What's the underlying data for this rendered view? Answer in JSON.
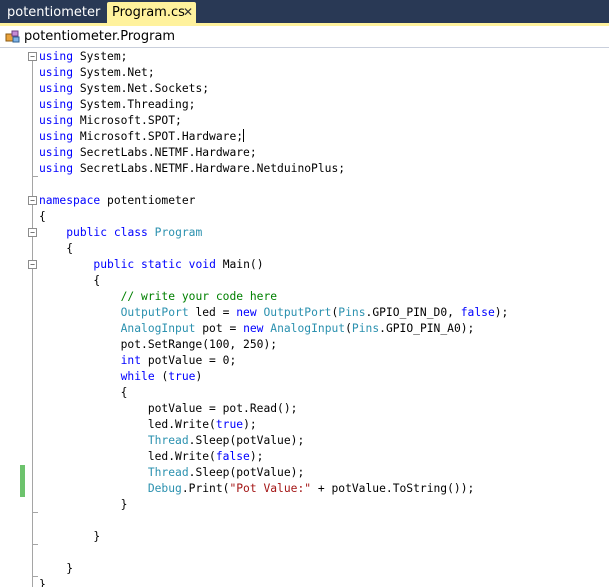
{
  "tabs": {
    "inactive_label": "potentiometer",
    "active_label": "Program.cs",
    "close_glyph": "✕"
  },
  "navbar": {
    "member_label": "potentiometer.Program",
    "icon": "class-icon"
  },
  "colors": {
    "tabbar_background": "#293955",
    "active_tab": "#fff29d",
    "keyword": "#0000ff",
    "type": "#2b91af",
    "comment": "#008000",
    "string": "#a31515",
    "change_marker": "#6dc36d"
  },
  "editor": {
    "lines": [
      [
        {
          "t": "kw",
          "s": "using"
        },
        {
          "t": "",
          "s": " System;"
        }
      ],
      [
        {
          "t": "kw",
          "s": "using"
        },
        {
          "t": "",
          "s": " System.Net;"
        }
      ],
      [
        {
          "t": "kw",
          "s": "using"
        },
        {
          "t": "",
          "s": " System.Net.Sockets;"
        }
      ],
      [
        {
          "t": "kw",
          "s": "using"
        },
        {
          "t": "",
          "s": " System.Threading;"
        }
      ],
      [
        {
          "t": "kw",
          "s": "using"
        },
        {
          "t": "",
          "s": " Microsoft.SPOT;"
        }
      ],
      [
        {
          "t": "kw",
          "s": "using"
        },
        {
          "t": "",
          "s": " Microsoft.SPOT.Hardware;"
        },
        {
          "t": "caret",
          "s": ""
        }
      ],
      [
        {
          "t": "kw",
          "s": "using"
        },
        {
          "t": "",
          "s": " SecretLabs.NETMF.Hardware;"
        }
      ],
      [
        {
          "t": "kw",
          "s": "using"
        },
        {
          "t": "",
          "s": " SecretLabs.NETMF.Hardware.NetduinoPlus;"
        }
      ],
      [],
      [
        {
          "t": "kw",
          "s": "namespace"
        },
        {
          "t": "",
          "s": " potentiometer"
        }
      ],
      [
        {
          "t": "",
          "s": "{"
        }
      ],
      [
        {
          "t": "",
          "s": "    "
        },
        {
          "t": "kw",
          "s": "public"
        },
        {
          "t": "",
          "s": " "
        },
        {
          "t": "kw",
          "s": "class"
        },
        {
          "t": "",
          "s": " "
        },
        {
          "t": "ty",
          "s": "Program"
        }
      ],
      [
        {
          "t": "",
          "s": "    {"
        }
      ],
      [
        {
          "t": "",
          "s": "        "
        },
        {
          "t": "kw",
          "s": "public"
        },
        {
          "t": "",
          "s": " "
        },
        {
          "t": "kw",
          "s": "static"
        },
        {
          "t": "",
          "s": " "
        },
        {
          "t": "kw",
          "s": "void"
        },
        {
          "t": "",
          "s": " Main()"
        }
      ],
      [
        {
          "t": "",
          "s": "        {"
        }
      ],
      [
        {
          "t": "",
          "s": "            "
        },
        {
          "t": "cm",
          "s": "// write your code here"
        }
      ],
      [
        {
          "t": "",
          "s": "            "
        },
        {
          "t": "ty",
          "s": "OutputPort"
        },
        {
          "t": "",
          "s": " led = "
        },
        {
          "t": "kw",
          "s": "new"
        },
        {
          "t": "",
          "s": " "
        },
        {
          "t": "ty",
          "s": "OutputPort"
        },
        {
          "t": "",
          "s": "("
        },
        {
          "t": "ty",
          "s": "Pins"
        },
        {
          "t": "",
          "s": ".GPIO_PIN_D0, "
        },
        {
          "t": "kw",
          "s": "false"
        },
        {
          "t": "",
          "s": ");"
        }
      ],
      [
        {
          "t": "",
          "s": "            "
        },
        {
          "t": "ty",
          "s": "AnalogInput"
        },
        {
          "t": "",
          "s": " pot = "
        },
        {
          "t": "kw",
          "s": "new"
        },
        {
          "t": "",
          "s": " "
        },
        {
          "t": "ty",
          "s": "AnalogInput"
        },
        {
          "t": "",
          "s": "("
        },
        {
          "t": "ty",
          "s": "Pins"
        },
        {
          "t": "",
          "s": ".GPIO_PIN_A0);"
        }
      ],
      [
        {
          "t": "",
          "s": "            pot.SetRange(100, 250);"
        }
      ],
      [
        {
          "t": "",
          "s": "            "
        },
        {
          "t": "kw",
          "s": "int"
        },
        {
          "t": "",
          "s": " potValue = 0;"
        }
      ],
      [
        {
          "t": "",
          "s": "            "
        },
        {
          "t": "kw",
          "s": "while"
        },
        {
          "t": "",
          "s": " ("
        },
        {
          "t": "kw",
          "s": "true"
        },
        {
          "t": "",
          "s": ")"
        }
      ],
      [
        {
          "t": "",
          "s": "            {"
        }
      ],
      [
        {
          "t": "",
          "s": "                potValue = pot.Read();"
        }
      ],
      [
        {
          "t": "",
          "s": "                led.Write("
        },
        {
          "t": "kw",
          "s": "true"
        },
        {
          "t": "",
          "s": ");"
        }
      ],
      [
        {
          "t": "",
          "s": "                "
        },
        {
          "t": "ty",
          "s": "Thread"
        },
        {
          "t": "",
          "s": ".Sleep(potValue);"
        }
      ],
      [
        {
          "t": "",
          "s": "                led.Write("
        },
        {
          "t": "kw",
          "s": "false"
        },
        {
          "t": "",
          "s": ");"
        }
      ],
      [
        {
          "t": "",
          "s": "                "
        },
        {
          "t": "ty",
          "s": "Thread"
        },
        {
          "t": "",
          "s": ".Sleep(potValue);"
        }
      ],
      [
        {
          "t": "",
          "s": "                "
        },
        {
          "t": "ty",
          "s": "Debug"
        },
        {
          "t": "",
          "s": ".Print("
        },
        {
          "t": "st",
          "s": "\"Pot Value:\""
        },
        {
          "t": "",
          "s": " + potValue.ToString());"
        }
      ],
      [
        {
          "t": "",
          "s": "            }"
        }
      ],
      [],
      [
        {
          "t": "",
          "s": "        }"
        }
      ],
      [],
      [
        {
          "t": "",
          "s": "    }"
        }
      ],
      [
        {
          "t": "",
          "s": "}"
        }
      ]
    ],
    "fold_marks": [
      {
        "line": 0,
        "state": "expanded"
      },
      {
        "line": 9,
        "state": "expanded"
      },
      {
        "line": 11,
        "state": "expanded"
      },
      {
        "line": 13,
        "state": "expanded"
      }
    ],
    "changed_lines": [
      26,
      27
    ]
  }
}
